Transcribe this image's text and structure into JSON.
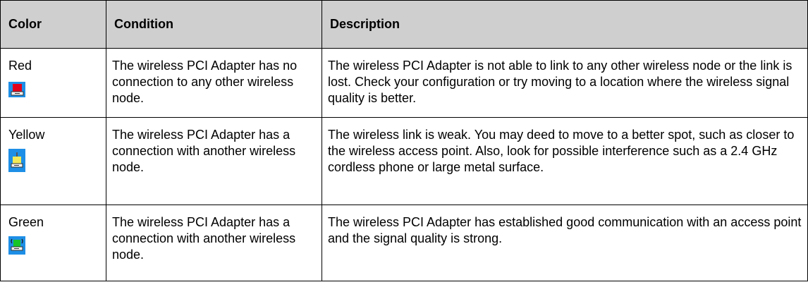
{
  "headers": {
    "color": "Color",
    "condition": "Condition",
    "description": "Description"
  },
  "rows": [
    {
      "color": "Red",
      "icon": "adapter-red-icon",
      "condition": "The wireless PCI Adapter has no connection to any other wireless node.",
      "description": "The wireless PCI Adapter is not able to link to any other wireless node or the link is lost. Check your configuration or try moving to a location where the wireless signal quality is better."
    },
    {
      "color": "Yellow",
      "icon": "adapter-yellow-icon",
      "condition": "The wireless PCI Adapter has a connection with another wireless node.",
      "description": "The wireless link is weak. You may deed to move to a better spot, such as closer to the wireless access point. Also, look for possible interference such as a 2.4 GHz cordless phone or large metal surface."
    },
    {
      "color": "Green",
      "icon": "adapter-green-icon",
      "condition": "The wireless PCI Adapter has a connection with another wireless node.",
      "description": "The wireless PCI Adapter has established good communication with an access point and the signal quality is strong."
    }
  ],
  "colors": {
    "header_bg": "#cfcfcf",
    "icon_bg": "#1e8fe6",
    "red": "#e3001b",
    "yellow": "#f2ea58",
    "green": "#18c428"
  }
}
